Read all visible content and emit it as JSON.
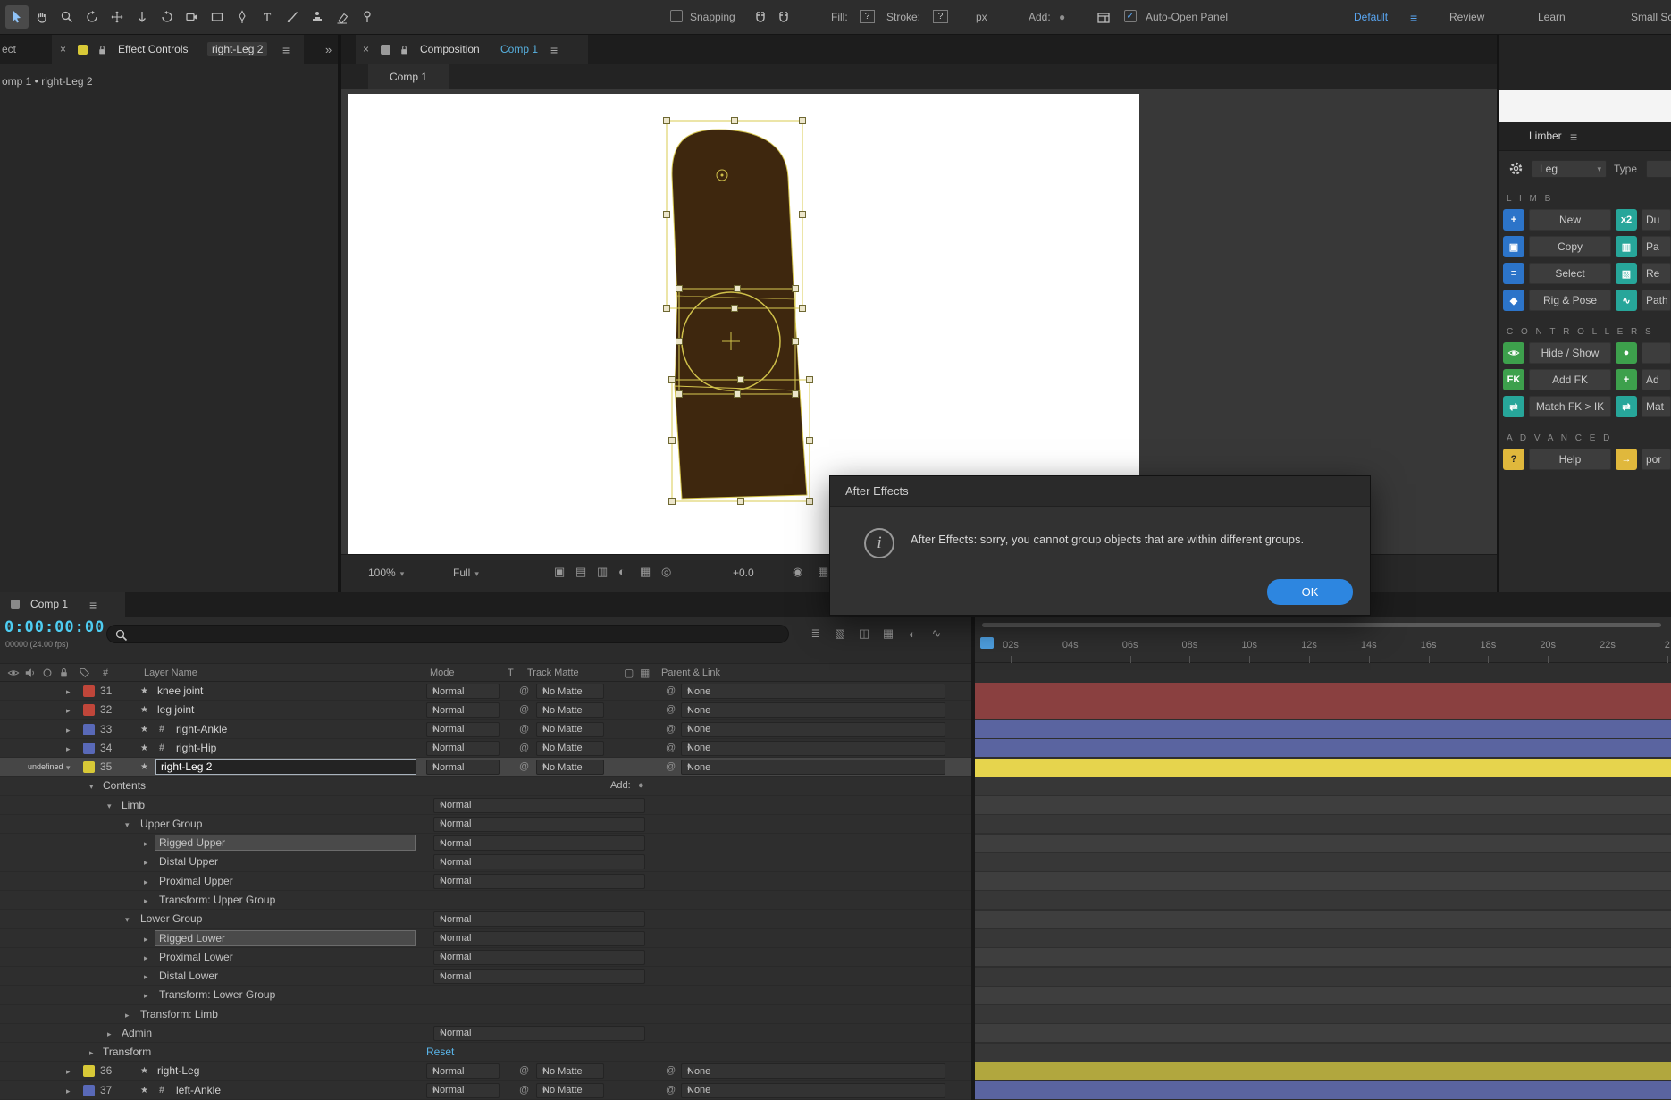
{
  "icons": {
    "close": "×",
    "menu": "≡",
    "more": "»",
    "chevron_down": "▾",
    "twirl_open": "▾",
    "twirl_closed": "▸",
    "star": "★",
    "null_badge": "#",
    "pickwhip": "@",
    "add_bullet": "●",
    "check": "✓",
    "camera": "◉"
  },
  "toolbar": {
    "tools": [
      {
        "name": "selection-tool",
        "active": true
      },
      {
        "name": "hand-tool",
        "active": false
      },
      {
        "name": "zoom-tool",
        "active": false
      },
      {
        "name": "orbit-camera-tool",
        "active": false
      },
      {
        "name": "pan-camera-tool",
        "active": false
      },
      {
        "name": "dolly-camera-tool",
        "active": false
      },
      {
        "name": "rotation-tool",
        "active": false
      },
      {
        "name": "camera-tool",
        "active": false
      },
      {
        "name": "rectangle-tool",
        "active": false
      },
      {
        "name": "pen-tool",
        "active": false
      },
      {
        "name": "type-tool",
        "active": false
      },
      {
        "name": "brush-tool",
        "active": false
      },
      {
        "name": "clone-stamp-tool",
        "active": false
      },
      {
        "name": "eraser-tool",
        "active": false
      },
      {
        "name": "puppet-pin-tool",
        "active": false
      }
    ],
    "snapping_label": "Snapping",
    "fill_label": "Fill:",
    "fill_value": "?",
    "stroke_label": "Stroke:",
    "stroke_value": "?",
    "px_label": "px",
    "add_label": "Add:",
    "auto_open_panel_label": "Auto-Open Panel",
    "auto_open_checked": true,
    "workspaces": [
      {
        "label": "Default",
        "active": true
      },
      {
        "label": "Review",
        "active": false
      },
      {
        "label": "Learn",
        "active": false
      },
      {
        "label": "Small Sc",
        "active": false
      }
    ]
  },
  "effect_controls": {
    "partial_tab": "ect",
    "title": "Effect Controls",
    "layer": "right-Leg 2",
    "breadcrumb": "omp 1 • right-Leg 2"
  },
  "composition": {
    "title": "Composition",
    "name": "Comp 1",
    "viewer_tab": "Comp 1",
    "zoom": "100%",
    "resolution": "Full",
    "exposure": "+0.0"
  },
  "limber": {
    "title": "Limber",
    "preset": "Leg",
    "type_label": "Type",
    "sections": [
      {
        "header": "LIMB",
        "rows": [
          {
            "icon": "new-icon",
            "label": "New",
            "right_icon": "duplicate-icon",
            "right_label": "Du"
          },
          {
            "icon": "copy-icon",
            "label": "Copy",
            "right_icon": "paste-icon",
            "right_label": "Pa"
          },
          {
            "icon": "select-icon",
            "label": "Select",
            "right_icon": "rename-icon",
            "right_label": "Re"
          },
          {
            "icon": "rig-pose-icon",
            "label": "Rig & Pose",
            "right_icon": "path-icon",
            "right_label": "Path"
          }
        ]
      },
      {
        "header": "CONTROLLERS",
        "rows": [
          {
            "icon": "hide-show-icon",
            "label": "Hide / Show",
            "right_icon": "controller-dot-icon",
            "right_label": ""
          },
          {
            "icon": "add-fk-icon",
            "label": "Add FK",
            "right_icon": "add-icon",
            "right_label": "Ad"
          },
          {
            "icon": "match-fk-ik-icon",
            "label": "Match FK > IK",
            "right_icon": "match-icon",
            "right_label": "Mat"
          }
        ]
      },
      {
        "header": "ADVANCED",
        "rows": [
          {
            "icon": "help-icon",
            "label": "Help",
            "right_icon": "import-icon",
            "right_label": "por"
          }
        ]
      }
    ]
  },
  "dialog": {
    "title": "After Effects",
    "message": "After Effects: sorry, you cannot group objects that are within different groups.",
    "ok_label": "OK"
  },
  "timeline": {
    "tab": "Comp 1",
    "current_time": "0:00:00:00",
    "frame_info": "00000 (24.00 fps)",
    "columns": [
      "Layer Name",
      "Mode",
      "T",
      "Track Matte",
      "Parent & Link"
    ],
    "add_label": "Add:",
    "reset_label": "Reset",
    "ruler_ticks": [
      "02s",
      "04s",
      "06s",
      "08s",
      "10s",
      "12s",
      "14s",
      "16s",
      "18s",
      "20s",
      "22s",
      "2"
    ],
    "right_icons": [
      "comp-mini-flowchart-icon",
      "draft-3d-icon",
      "shy-icon",
      "frame-blend-icon",
      "motion-blur-icon",
      "graph-editor-icon"
    ],
    "av_icons": [
      "eye-icon",
      "audio-icon",
      "solo-icon",
      "lock-icon"
    ],
    "rows": [
      {
        "type": "layer",
        "num": "31",
        "name": "knee joint",
        "label_color": "#c0463a",
        "is_null": false,
        "mode": "Normal",
        "matte": "No Matte",
        "parent": "None",
        "track_color": "#8a4040",
        "twirl": "closed",
        "selected": false,
        "editing": false,
        "eye_dot": false
      },
      {
        "type": "layer",
        "num": "32",
        "name": "leg joint",
        "label_color": "#c0463a",
        "is_null": false,
        "mode": "Normal",
        "matte": "No Matte",
        "parent": "None",
        "track_color": "#8a4040",
        "twirl": "closed",
        "selected": false,
        "editing": false,
        "eye_dot": false
      },
      {
        "type": "layer",
        "num": "33",
        "name": "right-Ankle",
        "label_color": "#5969b8",
        "is_null": true,
        "mode": "Normal",
        "matte": "No Matte",
        "parent": "None",
        "track_color": "#5a64a0",
        "twirl": "closed",
        "selected": false,
        "editing": false,
        "eye_dot": false
      },
      {
        "type": "layer",
        "num": "34",
        "name": "right-Hip",
        "label_color": "#5969b8",
        "is_null": true,
        "mode": "Normal",
        "matte": "No Matte",
        "parent": "None",
        "track_color": "#5a64a0",
        "twirl": "closed",
        "selected": false,
        "editing": false,
        "eye_dot": false
      },
      {
        "type": "layer",
        "num": "35",
        "name": "right-Leg 2",
        "label_color": "#d8c937",
        "is_null": false,
        "mode": "Normal",
        "matte": "No Matte",
        "parent": "None",
        "track_color": "#e6d44d",
        "twirl": "open",
        "selected": true,
        "editing": true,
        "eye_dot": true
      },
      {
        "type": "prop",
        "indent": 1,
        "name": "Contents",
        "twirl": "open",
        "add_button": true
      },
      {
        "type": "prop",
        "indent": 2,
        "name": "Limb",
        "twirl": "open",
        "mode": "Normal"
      },
      {
        "type": "prop",
        "indent": 3,
        "name": "Upper Group",
        "twirl": "open",
        "mode": "Normal"
      },
      {
        "type": "prop",
        "indent": 4,
        "name": "Rigged Upper",
        "twirl": "closed",
        "mode": "Normal",
        "highlight": true
      },
      {
        "type": "prop",
        "indent": 4,
        "name": "Distal Upper",
        "twirl": "closed",
        "mode": "Normal"
      },
      {
        "type": "prop",
        "indent": 4,
        "name": "Proximal Upper",
        "twirl": "closed",
        "mode": "Normal"
      },
      {
        "type": "prop",
        "indent": 4,
        "name": "Transform: Upper Group",
        "twirl": "closed"
      },
      {
        "type": "prop",
        "indent": 3,
        "name": "Lower Group",
        "twirl": "open",
        "mode": "Normal"
      },
      {
        "type": "prop",
        "indent": 4,
        "name": "Rigged Lower",
        "twirl": "closed",
        "mode": "Normal",
        "highlight": true
      },
      {
        "type": "prop",
        "indent": 4,
        "name": "Proximal Lower",
        "twirl": "closed",
        "mode": "Normal"
      },
      {
        "type": "prop",
        "indent": 4,
        "name": "Distal Lower",
        "twirl": "closed",
        "mode": "Normal"
      },
      {
        "type": "prop",
        "indent": 4,
        "name": "Transform: Lower Group",
        "twirl": "closed"
      },
      {
        "type": "prop",
        "indent": 3,
        "name": "Transform: Limb",
        "twirl": "closed"
      },
      {
        "type": "prop",
        "indent": 2,
        "name": "Admin",
        "twirl": "closed",
        "mode": "Normal"
      },
      {
        "type": "prop",
        "indent": 1,
        "name": "Transform",
        "twirl": "closed",
        "reset": true
      },
      {
        "type": "layer",
        "num": "36",
        "name": "right-Leg",
        "label_color": "#d8c937",
        "is_null": false,
        "mode": "Normal",
        "matte": "No Matte",
        "parent": "None",
        "track_color": "#b1a73e",
        "twirl": "closed",
        "selected": false,
        "editing": false,
        "eye_dot": false
      },
      {
        "type": "layer",
        "num": "37",
        "name": "left-Ankle",
        "label_color": "#5969b8",
        "is_null": true,
        "mode": "Normal",
        "matte": "No Matte",
        "parent": "None",
        "track_color": "#5a64a0",
        "twirl": "closed",
        "selected": false,
        "editing": false,
        "eye_dot": false
      }
    ]
  }
}
